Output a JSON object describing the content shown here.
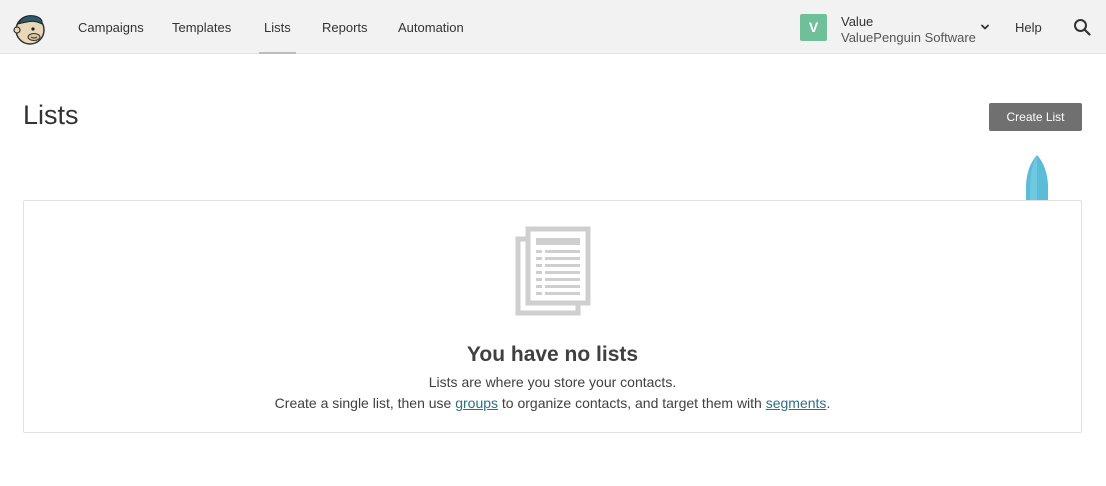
{
  "nav": {
    "items": [
      {
        "label": "Campaigns",
        "active": false
      },
      {
        "label": "Templates",
        "active": false
      },
      {
        "label": "Lists",
        "active": true
      },
      {
        "label": "Reports",
        "active": false
      },
      {
        "label": "Automation",
        "active": false
      }
    ],
    "account": {
      "avatar_letter": "V",
      "avatar_color": "#6fbf9b",
      "name": "Value",
      "organization": "ValuePenguin Software"
    },
    "help_label": "Help",
    "search_icon": "search-icon"
  },
  "page": {
    "title": "Lists",
    "create_button": "Create List"
  },
  "empty_state": {
    "icon": "document-icon",
    "title": "You have no lists",
    "line1": "Lists are where you store your contacts.",
    "line2_before": "Create a single list, then use ",
    "groups_link": "groups",
    "line2_middle": " to organize contacts, and target them with ",
    "segments_link": "segments",
    "line2_after": "."
  },
  "colors": {
    "link": "#2c6e8a",
    "button_bg": "#707070",
    "drop_marker": "#5bbcd8"
  }
}
